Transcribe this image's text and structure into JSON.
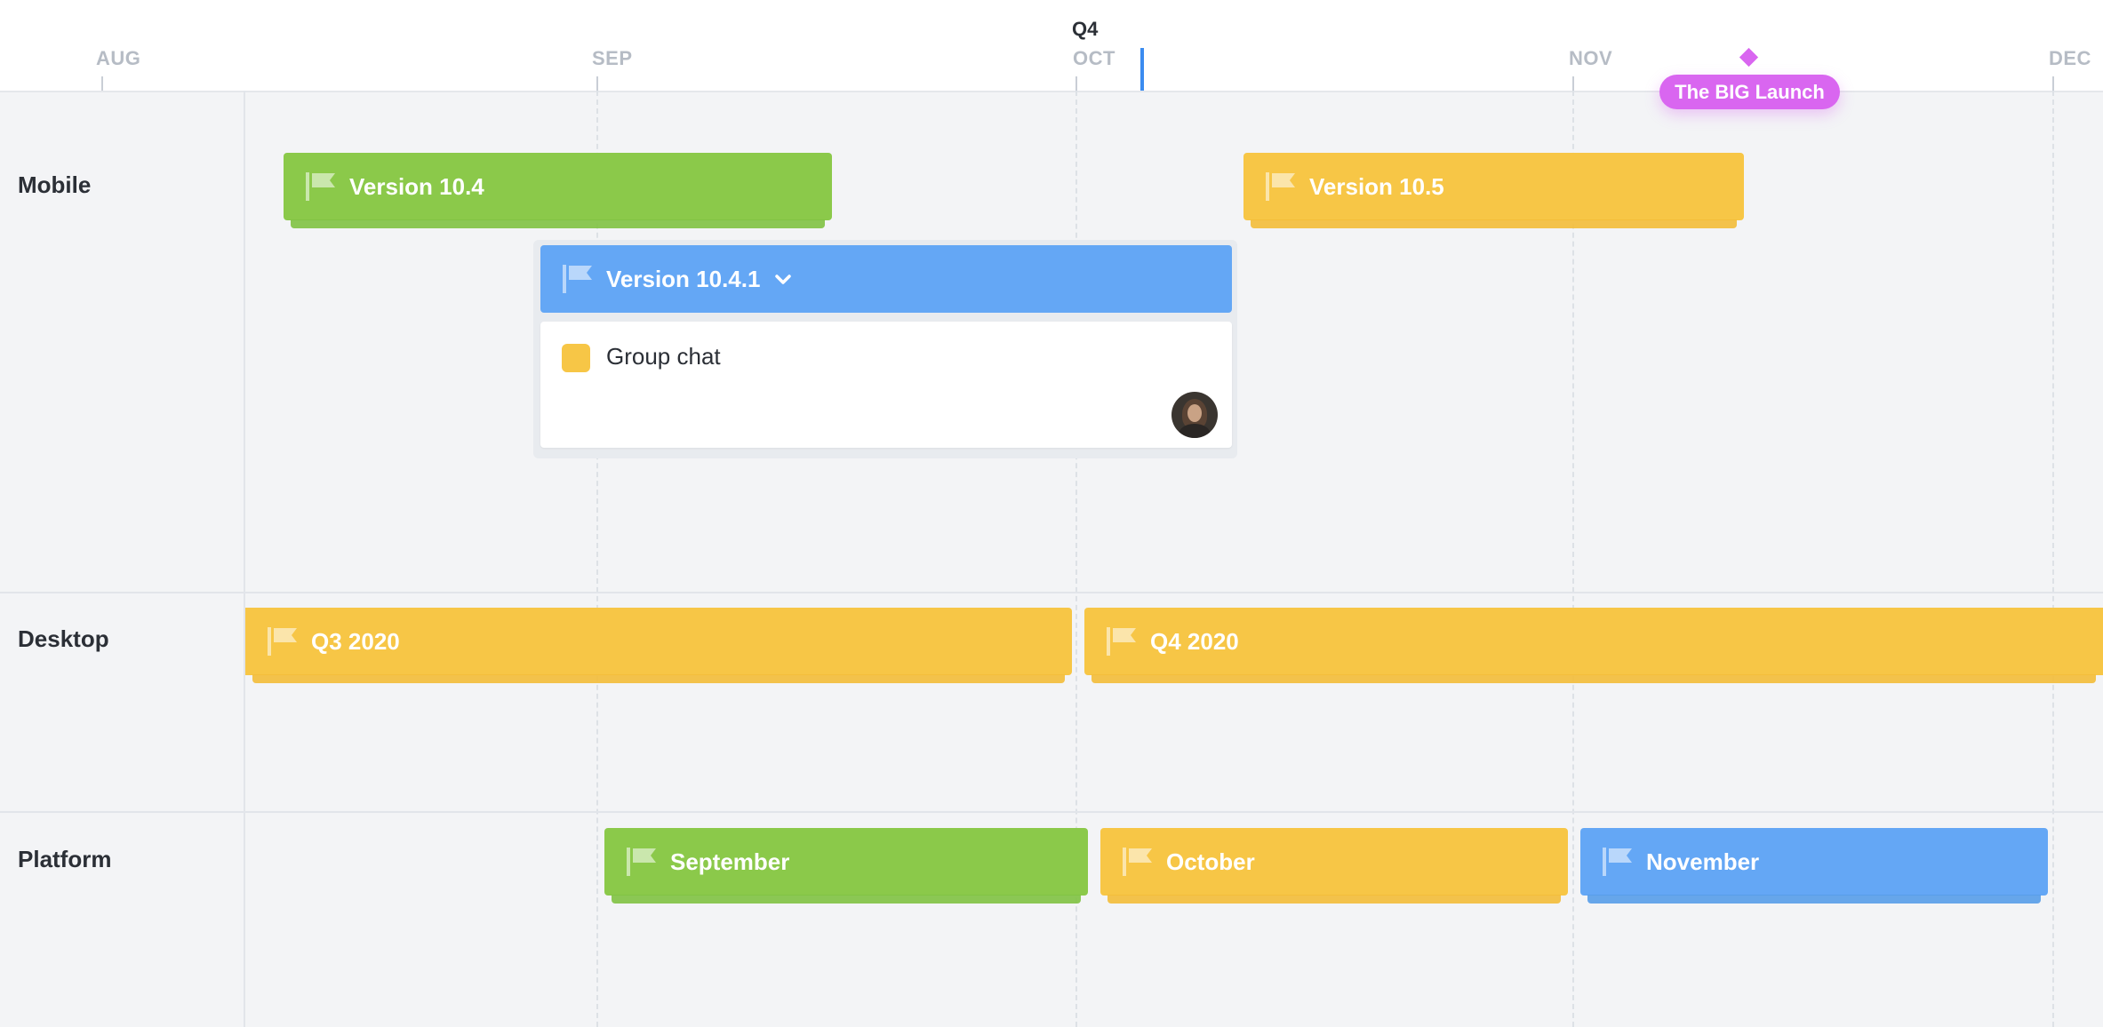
{
  "timeline": {
    "months": [
      "AUG",
      "SEP",
      "OCT",
      "NOV",
      "DEC"
    ],
    "quarter": "Q4",
    "milestone": {
      "label": "The BIG Launch",
      "color": "#d966f0"
    },
    "today_color": "#3b8cf0"
  },
  "lanes": [
    {
      "label": "Mobile"
    },
    {
      "label": "Desktop"
    },
    {
      "label": "Platform"
    }
  ],
  "bars": {
    "mobile": [
      {
        "label": "Version 10.4",
        "color": "green"
      },
      {
        "label": "Version 10.5",
        "color": "yellow"
      }
    ],
    "mobile_expanded": {
      "label": "Version 10.4.1",
      "color": "blue",
      "card": {
        "title": "Group chat",
        "swatch_color": "#f7c646"
      }
    },
    "desktop": [
      {
        "label": "Q3 2020",
        "color": "yellow"
      },
      {
        "label": "Q4 2020",
        "color": "yellow"
      }
    ],
    "platform": [
      {
        "label": "September",
        "color": "green"
      },
      {
        "label": "October",
        "color": "yellow"
      },
      {
        "label": "November",
        "color": "blue"
      }
    ]
  },
  "icons": {
    "bar": "flag-icon",
    "expand": "chevron-down-icon",
    "assignee": "avatar"
  }
}
